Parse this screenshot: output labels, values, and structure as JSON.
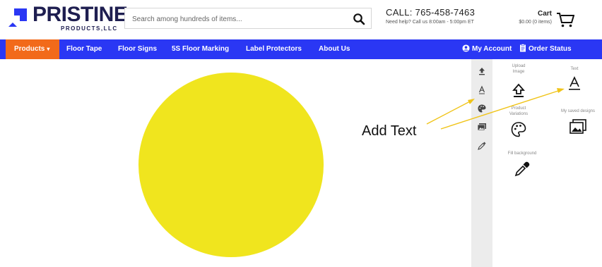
{
  "header": {
    "logo_text": "PRISTINE",
    "logo_sub": "PRODUCTS,LLC",
    "search_placeholder": "Search among hundreds of items...",
    "call_main": "CALL: 765-458-7463",
    "call_sub": "Need help? Call us 8:00am - 5:00pm ET",
    "cart_label": "Cart",
    "cart_sub": "$0.00 (0 items)"
  },
  "nav": {
    "products": "Products",
    "items": [
      "Floor Tape",
      "Floor Signs",
      "5S Floor Marking",
      "Label Protectors",
      "About Us"
    ],
    "my_account": "My Account",
    "order_status": "Order Status"
  },
  "canvas": {
    "shape": "circle",
    "fill_color": "#f0e51e"
  },
  "panel": {
    "tiles": {
      "upload": "Upload Image",
      "text": "Text",
      "variations": "Product Variations",
      "saved": "My saved designs",
      "fill": "Fill background"
    }
  },
  "annotation": {
    "label": "Add Text"
  },
  "colors": {
    "nav_bg": "#2a37f4",
    "products_bg": "#f26a1a",
    "brand_dark": "#1e1e50"
  }
}
